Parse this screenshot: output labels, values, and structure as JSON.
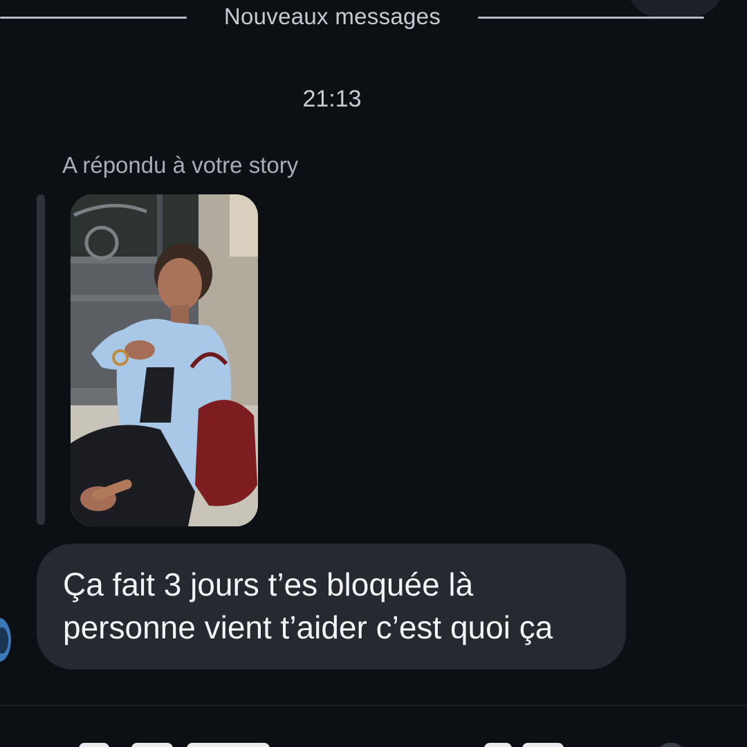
{
  "thread": {
    "new_messages_divider": "Nouveaux messages",
    "timestamp": "21:13"
  },
  "story_reply": {
    "context_label": "A répondu à votre story",
    "thumbnail": {
      "description_icon": "story-photo-icon"
    }
  },
  "message": {
    "lines": [
      "Ça fait 3 jours t’es bloquée là",
      "personne vient t’aider c’est quoi ça"
    ]
  },
  "colors": {
    "background": "#0c1015",
    "bubble": "#262a30",
    "divider_line": "#b8bcc4",
    "text_primary": "#f4f5f7",
    "text_secondary": "#a9adb5"
  }
}
